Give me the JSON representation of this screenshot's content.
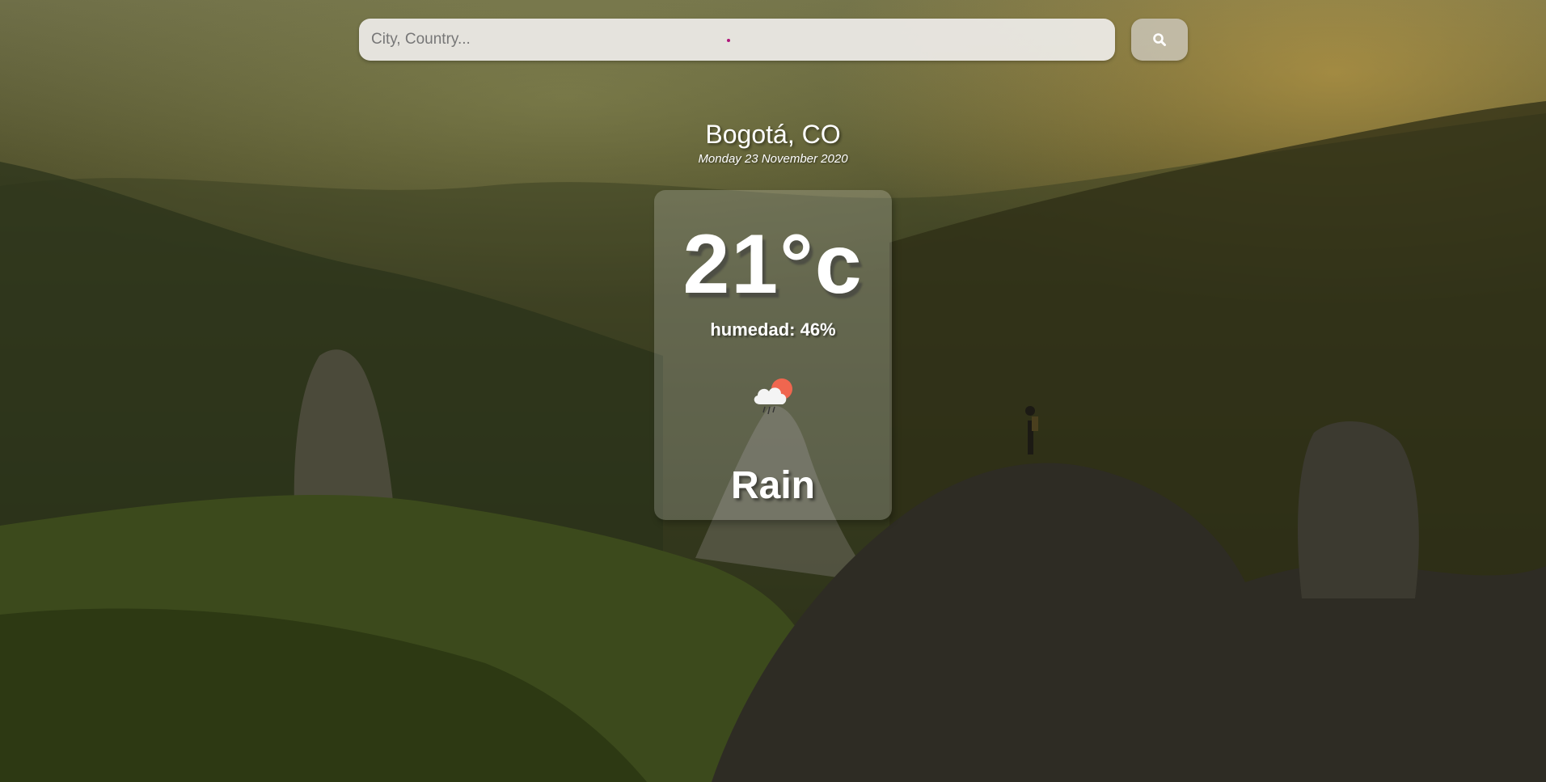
{
  "search": {
    "placeholder": "City, Country...",
    "value": "",
    "button_icon": "search-icon"
  },
  "location": {
    "name": "Bogotá, CO",
    "date": "Monday 23 November 2020"
  },
  "weather": {
    "temperature": "21°c",
    "humidity": "humedad: 46%",
    "icon": "cloud-rain-sun-icon",
    "condition": "Rain"
  },
  "colors": {
    "card_background": "#ffffff33",
    "search_background": "#eeece8",
    "sun": "#f0664f",
    "text": "#ffffff"
  }
}
